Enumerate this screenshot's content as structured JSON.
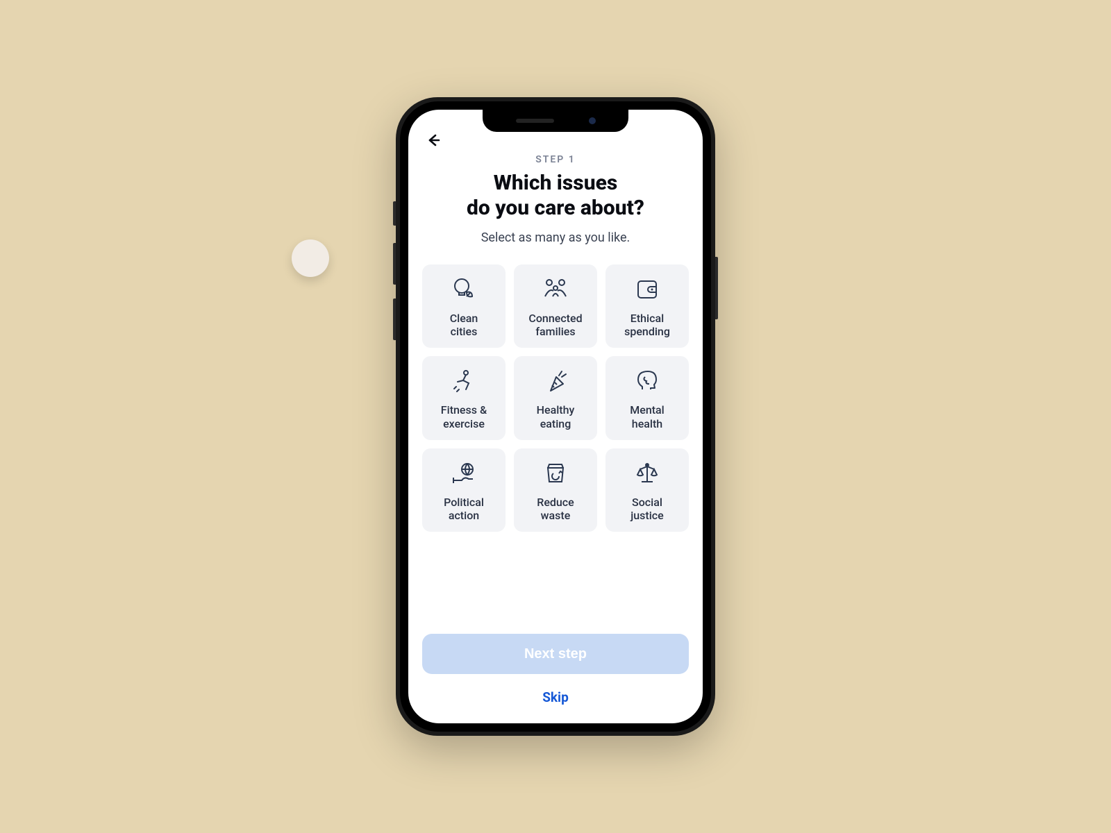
{
  "header": {
    "step_label": "STEP 1",
    "title_line1": "Which issues",
    "title_line2": "do you care about?",
    "subtitle": "Select as many as you like."
  },
  "issues": [
    {
      "id": "clean-cities",
      "label": "Clean\ncities",
      "icon": "bulb-leaf-icon"
    },
    {
      "id": "connected-families",
      "label": "Connected\nfamilies",
      "icon": "family-icon"
    },
    {
      "id": "ethical-spending",
      "label": "Ethical\nspending",
      "icon": "wallet-icon"
    },
    {
      "id": "fitness-exercise",
      "label": "Fitness &\nexercise",
      "icon": "running-icon"
    },
    {
      "id": "healthy-eating",
      "label": "Healthy\neating",
      "icon": "carrot-icon"
    },
    {
      "id": "mental-health",
      "label": "Mental\nhealth",
      "icon": "head-brain-icon"
    },
    {
      "id": "political-action",
      "label": "Political\naction",
      "icon": "hand-globe-icon"
    },
    {
      "id": "reduce-waste",
      "label": "Reduce\nwaste",
      "icon": "recycle-box-icon"
    },
    {
      "id": "social-justice",
      "label": "Social\njustice",
      "icon": "scales-icon"
    }
  ],
  "footer": {
    "next_label": "Next step",
    "skip_label": "Skip"
  },
  "colors": {
    "icon_stroke": "#2b3850"
  }
}
